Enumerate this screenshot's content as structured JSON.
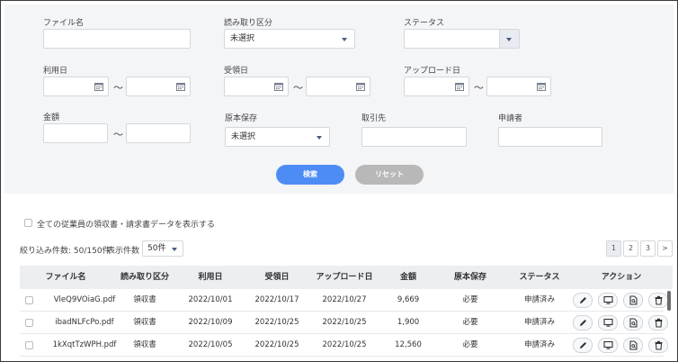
{
  "filters": {
    "file_name_label": "ファイル名",
    "read_type_label": "読み取り区分",
    "read_type_value": "未選択",
    "status_label": "ステータス",
    "use_date_label": "利用日",
    "receipt_date_label": "受領日",
    "upload_date_label": "アップロード日",
    "tilde": "〜",
    "amount_label": "金額",
    "original_storage_label": "原本保存",
    "original_storage_value": "未選択",
    "client_label": "取引先",
    "applicant_label": "申請者",
    "search_button": "検索",
    "reset_button": "リセット"
  },
  "options": {
    "show_all_label": "全ての従業員の領収書・請求書データを表示する"
  },
  "results": {
    "count_text": "絞り込み件数: 50/150件",
    "per_page_label": "表示件数",
    "per_page_value": "50件"
  },
  "pagination": [
    "1",
    "2",
    "3",
    ">"
  ],
  "table": {
    "headers": [
      "ファイル名",
      "読み取り区分",
      "利用日",
      "受領日",
      "アップロード日",
      "金額",
      "原本保存",
      "ステータス",
      "アクション"
    ],
    "rows": [
      {
        "file": "VleQ9VOiaG.pdf",
        "type": "領収書",
        "use_date": "2022/10/01",
        "receipt_date": "2022/10/17",
        "upload_date": "2022/10/27",
        "amount": "9,669",
        "original": "必要",
        "status": "申請済み"
      },
      {
        "file": "ibadNLFcPo.pdf",
        "type": "領収書",
        "use_date": "2022/10/09",
        "receipt_date": "2022/10/25",
        "upload_date": "2022/10/25",
        "amount": "1,900",
        "original": "必要",
        "status": "申請済み"
      },
      {
        "file": "1kXqtTzWPH.pdf",
        "type": "領収書",
        "use_date": "2022/10/05",
        "receipt_date": "2022/10/25",
        "upload_date": "2022/10/25",
        "amount": "12,560",
        "original": "必要",
        "status": "申請済み"
      }
    ]
  },
  "icons": {
    "calendar": "calendar-icon",
    "edit": "pencil-icon",
    "preview": "monitor-icon",
    "document": "document-search-icon",
    "delete": "trash-icon"
  },
  "colors": {
    "primary": "#4d8cf5",
    "reset": "#b8b8b8",
    "panel": "#f4f5f7",
    "header": "#eceef1"
  }
}
